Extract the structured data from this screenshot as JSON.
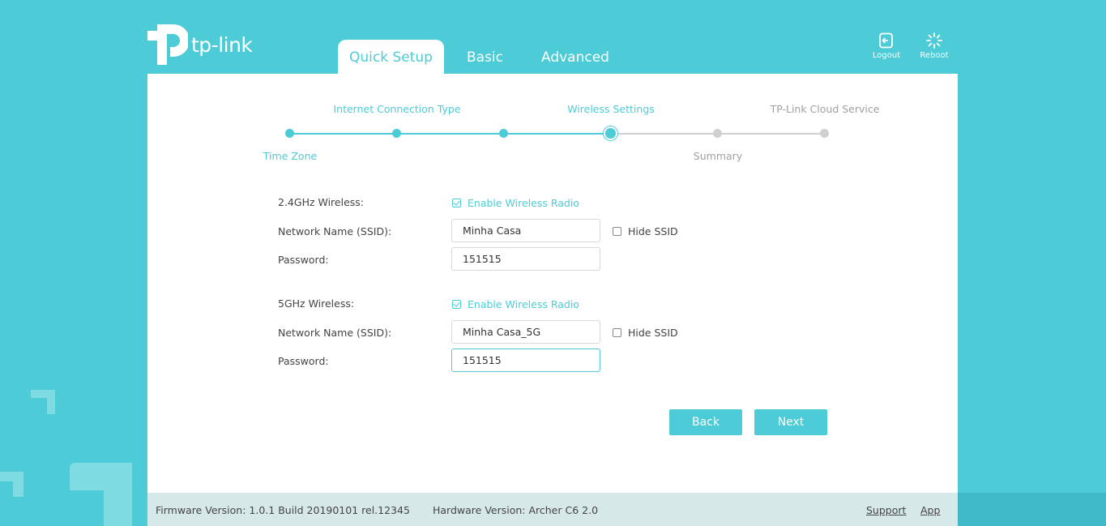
{
  "brand": {
    "logo_text": "tp-link"
  },
  "nav": {
    "tabs": [
      {
        "label": "Quick Setup",
        "active": true
      },
      {
        "label": "Basic",
        "active": false
      },
      {
        "label": "Advanced",
        "active": false
      }
    ],
    "logout_label": "Logout",
    "reboot_label": "Reboot"
  },
  "wizard": {
    "steps": [
      {
        "label": "Time Zone",
        "status": "done"
      },
      {
        "label": "Internet Connection Type",
        "status": "done"
      },
      {
        "label": "",
        "status": "done"
      },
      {
        "label": "Wireless Settings",
        "status": "current"
      },
      {
        "label": "Summary",
        "status": "todo"
      },
      {
        "label": "TP-Link Cloud Service",
        "status": "todo"
      }
    ]
  },
  "wireless": {
    "band24": {
      "section_label": "2.4GHz Wireless:",
      "enable_label": "Enable Wireless Radio",
      "enabled": true,
      "ssid_label": "Network Name (SSID):",
      "ssid_value": "Minha Casa",
      "hide_ssid_label": "Hide SSID",
      "hide_ssid": false,
      "password_label": "Password:",
      "password_value": "151515"
    },
    "band5": {
      "section_label": "5GHz Wireless:",
      "enable_label": "Enable Wireless Radio",
      "enabled": true,
      "ssid_label": "Network Name (SSID):",
      "ssid_value": "Minha Casa_5G",
      "hide_ssid_label": "Hide SSID",
      "hide_ssid": false,
      "password_label": "Password:",
      "password_value": "151515"
    }
  },
  "buttons": {
    "back": "Back",
    "next": "Next"
  },
  "footer": {
    "firmware": "Firmware Version: 1.0.1 Build 20190101 rel.12345",
    "hardware": "Hardware Version: Archer C6 2.0",
    "support": "Support",
    "app": "App"
  },
  "colors": {
    "accent": "#4dcbd6",
    "background": "#4dcbd6",
    "footer": "#d7e8e8"
  }
}
